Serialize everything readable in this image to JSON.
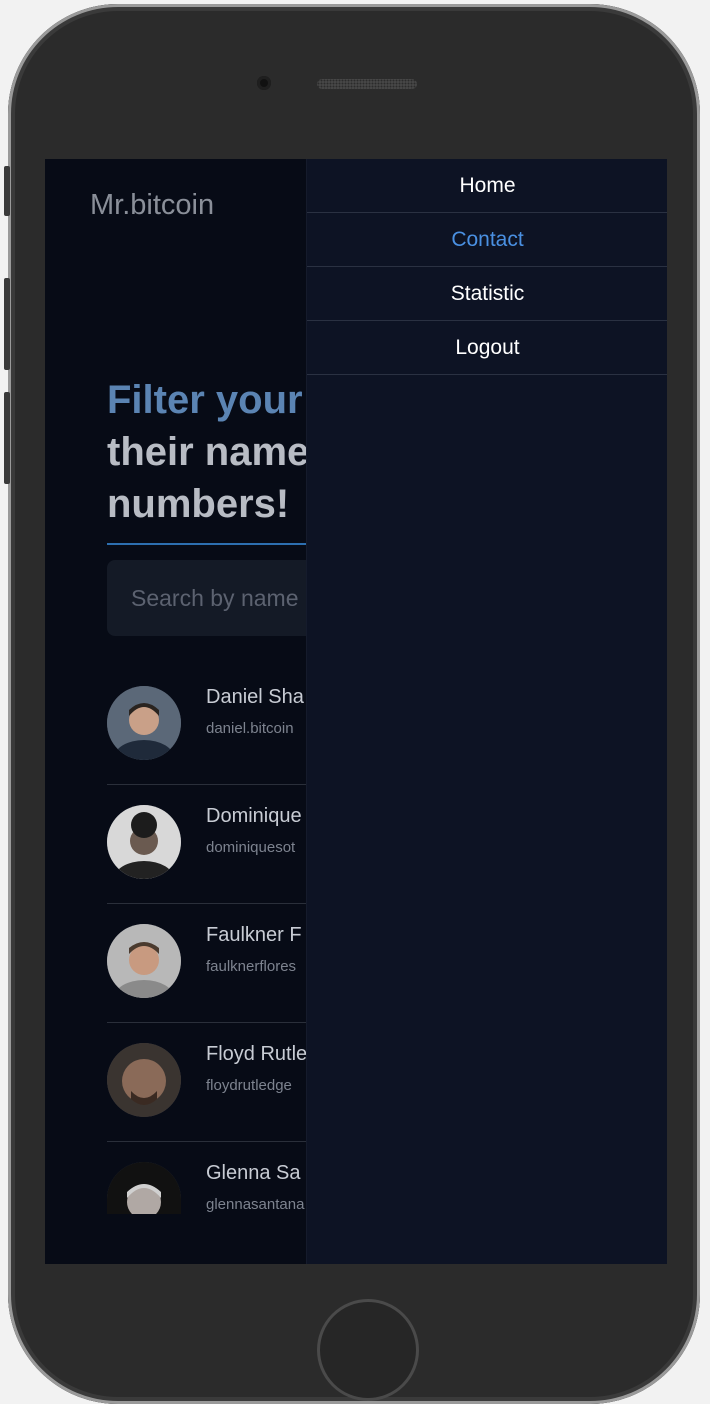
{
  "app": {
    "logo": "Mr.bitcoin"
  },
  "hero": {
    "line1": "Filter your",
    "line2": "their name",
    "line3": "numbers!"
  },
  "search": {
    "placeholder": "Search by name"
  },
  "contacts": [
    {
      "name": "Daniel Sha",
      "email": "daniel.bitcoin"
    },
    {
      "name": "Dominique",
      "email": "dominiquesot"
    },
    {
      "name": "Faulkner F",
      "email": "faulknerflores"
    },
    {
      "name": "Floyd Rutle",
      "email": "floydrutledge"
    },
    {
      "name": "Glenna Sa",
      "email": "glennasantana"
    }
  ],
  "menu": {
    "items": [
      {
        "label": "Home",
        "active": false
      },
      {
        "label": "Contact",
        "active": true
      },
      {
        "label": "Statistic",
        "active": false
      },
      {
        "label": "Logout",
        "active": false
      }
    ]
  },
  "colors": {
    "accent": "#4a90e2",
    "background": "#070b16",
    "menu_bg": "#0d1324"
  }
}
